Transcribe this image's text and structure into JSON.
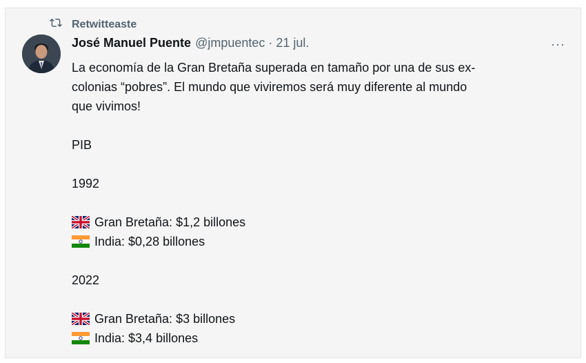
{
  "retweet": {
    "icon": "retweet-icon",
    "label": "Retwitteaste"
  },
  "tweet": {
    "author_name": "José Manuel Puente",
    "handle": "@jmpuentec",
    "separator": "·",
    "date": "21 jul.",
    "more_icon": "more-icon",
    "more_label": "···",
    "text_lines": [
      "La economía de la Gran Bretaña superada en tamaño por una de sus ex-",
      "colonias “pobres”. El mundo que viviremos será muy diferente al mundo",
      "que vivimos!"
    ],
    "pib_label": "PIB",
    "sections": [
      {
        "year": "1992",
        "rows": [
          {
            "flag": "uk-flag-icon",
            "text": "Gran Bretaña: $1,2 billones"
          },
          {
            "flag": "india-flag-icon",
            "text": "India: $0,28 billones"
          }
        ]
      },
      {
        "year": "2022",
        "rows": [
          {
            "flag": "uk-flag-icon",
            "text": "Gran Bretaña: $3 billones"
          },
          {
            "flag": "india-flag-icon",
            "text": "India: $3,4 billones"
          }
        ]
      }
    ]
  },
  "colors": {
    "card_background": "#f5f5f5",
    "secondary_text": "#536471",
    "primary_text": "#0f1419"
  }
}
